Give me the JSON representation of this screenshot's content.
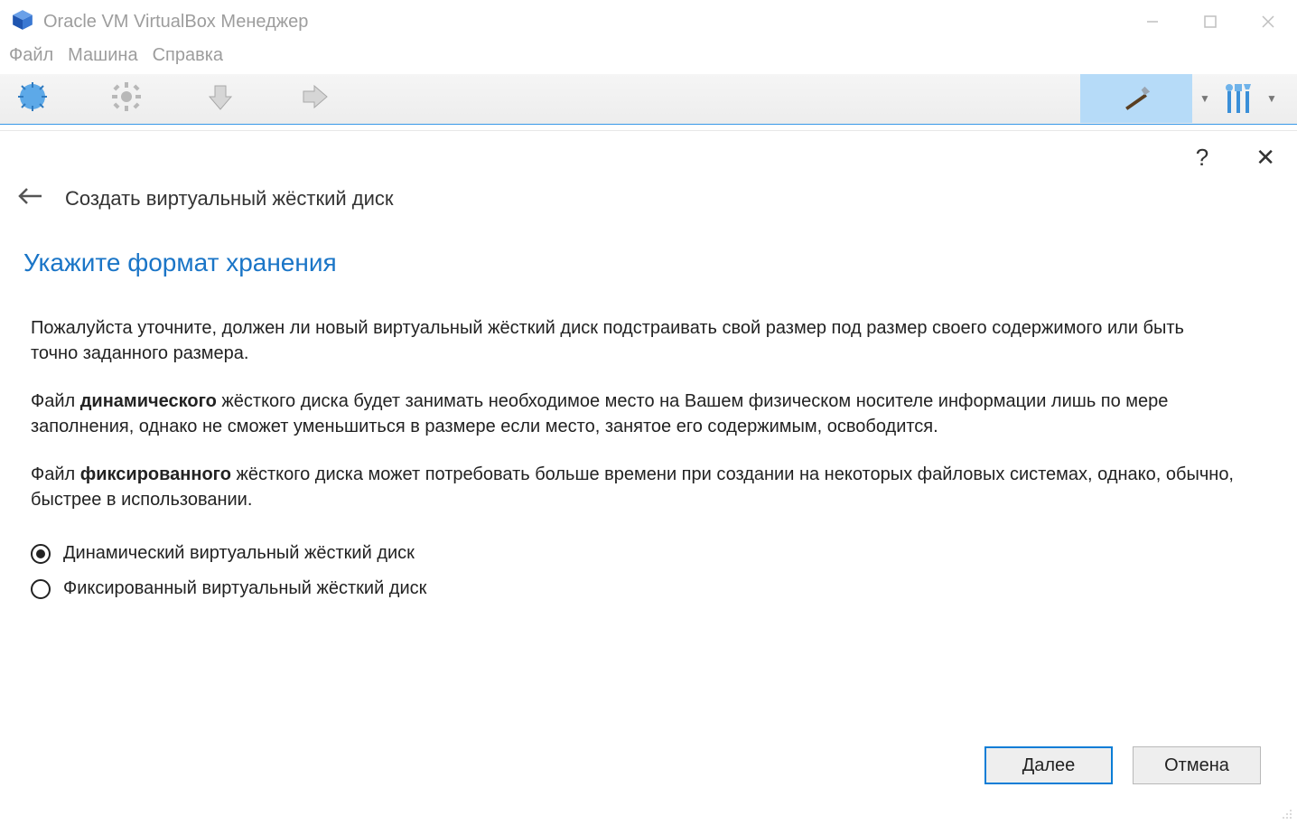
{
  "titlebar": {
    "title": "Oracle VM VirtualBox Менеджер"
  },
  "menubar": {
    "file": "Файл",
    "machine": "Машина",
    "help": "Справка"
  },
  "toolbar": {
    "cut_label": "Создать"
  },
  "dialog_controls": {
    "help": "?",
    "close": "✕"
  },
  "breadcrumb": {
    "title": "Создать виртуальный жёсткий диск"
  },
  "step": {
    "title": "Укажите формат хранения"
  },
  "body": {
    "p1": "Пожалуйста уточните, должен ли новый виртуальный жёсткий диск подстраивать свой размер под размер своего содержимого или быть точно заданного размера.",
    "p2_pre": "Файл ",
    "p2_bold": "динамического",
    "p2_post": " жёсткого диска будет занимать необходимое место на Вашем физическом носителе информации лишь по мере заполнения, однако не сможет уменьшиться в размере если место, занятое его содержимым, освободится.",
    "p3_pre": "Файл ",
    "p3_bold": "фиксированного",
    "p3_post": " жёсткого диска может потребовать больше времени при создании на некоторых файловых системах, однако, обычно, быстрее в использовании."
  },
  "radios": {
    "dynamic": "Динамический виртуальный жёсткий диск",
    "fixed": "Фиксированный виртуальный жёсткий диск"
  },
  "footer": {
    "next": "Далее",
    "cancel": "Отмена"
  }
}
